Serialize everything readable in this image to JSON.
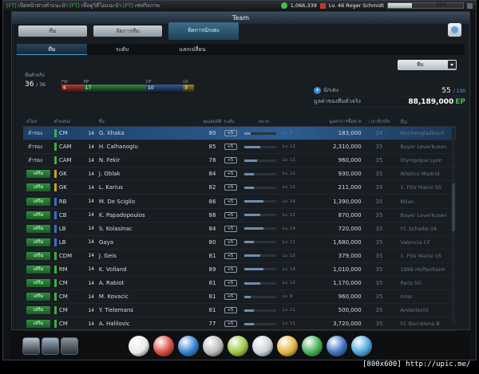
{
  "topbar": {
    "ticker_tag1": "[FT]",
    "ticker_text1": "เปิดหน้าต่างคำแนะนำ",
    "ticker_tag2": "[FT]",
    "ticker_text2": "เพื่อดูวิดีโอแนะนำ",
    "ticker_tag3": "[FT]",
    "ticker_text3": "เซฟกิจภาพ",
    "money": "1,066,339",
    "player_name": "Lv. 46 Roger Schmidt",
    "progress_label": "32%",
    "progress_value": 0.32
  },
  "window": {
    "title": "Team"
  },
  "tabs_main": [
    {
      "label": "ทีม"
    },
    {
      "label": "จัดการทีม"
    },
    {
      "label": "จัดการนักเตะ"
    }
  ],
  "tabs_sub": [
    {
      "label": "ทีม"
    },
    {
      "label": "ระดับ"
    },
    {
      "label": "แลกเปลี่ยน"
    }
  ],
  "filter": {
    "selected": "ทีม"
  },
  "team_strip": {
    "title": "ทีมตัวจริง",
    "count": "36",
    "total": "/ 36",
    "positions": [
      {
        "label": "FW",
        "count": "6",
        "color": "#c0392b"
      },
      {
        "label": "MF",
        "count": "17",
        "color": "#2f8f3e"
      },
      {
        "label": "DF",
        "count": "10",
        "color": "#2c5d9c"
      },
      {
        "label": "GK",
        "count": "3",
        "color": "#a08b1f"
      }
    ]
  },
  "info": {
    "players_label": "นักเตะ",
    "players_value": "55",
    "players_max": "/ 100",
    "value_label": "มูลค่าของทีมตัวจริง",
    "value_amount": "88,189,000",
    "value_unit": "EP"
  },
  "table_headers": [
    "สโมส",
    "ตำแหน่ง",
    "ชื่อ",
    "คุณสมบัติ",
    "ระดับ",
    "เลเวล",
    "มูลค่าการซื้อขาย",
    "เวลาที่เหลือ",
    "ทีม"
  ],
  "players": [
    {
      "status": "สำรอง",
      "badge": false,
      "pos": "CM",
      "poscolor": "#3fae3f",
      "name": "G. Xhaka",
      "ovr": "80",
      "lvl": "+5",
      "exp": 0.2,
      "lv": "Lv. 9",
      "price": "183,000",
      "age": "24",
      "club": "Mochengladbach",
      "selected": true
    },
    {
      "status": "สำรอง",
      "badge": false,
      "pos": "CAM",
      "poscolor": "#3fae3f",
      "name": "H. Calhanoglu",
      "ovr": "85",
      "lvl": "+5",
      "exp": 0.5,
      "lv": "Lv. 12",
      "price": "2,310,000",
      "age": "35",
      "club": "Bayer Leverkusen",
      "selected": false
    },
    {
      "status": "สำรอง",
      "badge": false,
      "pos": "CAM",
      "poscolor": "#3fae3f",
      "name": "N. Fekir",
      "ovr": "78",
      "lvl": "+5",
      "exp": 0.4,
      "lv": "Lv. 11",
      "price": "960,000",
      "age": "35",
      "club": "Olympique Lyon",
      "selected": false
    },
    {
      "status": "เสริม",
      "badge": true,
      "pos": "GK",
      "poscolor": "#c9a227",
      "name": "J. Oblak",
      "ovr": "84",
      "lvl": "+5",
      "exp": 0.3,
      "lv": "Lv. 11",
      "price": "930,000",
      "age": "35",
      "club": "Atletico Madrid",
      "selected": false
    },
    {
      "status": "เสริม",
      "badge": true,
      "pos": "GK",
      "poscolor": "#c9a227",
      "name": "L. Karius",
      "ovr": "82",
      "lvl": "+5",
      "exp": 0.3,
      "lv": "Lv. 11",
      "price": "211,000",
      "age": "39",
      "club": "1. FSV Mainz 05",
      "selected": false
    },
    {
      "status": "เสริม",
      "badge": true,
      "pos": "RB",
      "poscolor": "#3b6fc4",
      "name": "M. De Sciglio",
      "ovr": "86",
      "lvl": "+5",
      "exp": 0.6,
      "lv": "Lv. 14",
      "price": "1,390,000",
      "age": "35",
      "club": "Milan",
      "selected": false
    },
    {
      "status": "เสริม",
      "badge": true,
      "pos": "CB",
      "poscolor": "#3b6fc4",
      "name": "K. Papadopoulos",
      "ovr": "88",
      "lvl": "+5",
      "exp": 0.5,
      "lv": "Lv. 12",
      "price": "870,000",
      "age": "35",
      "club": "Bayer Leverkusen",
      "selected": false
    },
    {
      "status": "เสริม",
      "badge": true,
      "pos": "LB",
      "poscolor": "#3b6fc4",
      "name": "S. Kolasinac",
      "ovr": "84",
      "lvl": "+5",
      "exp": 0.6,
      "lv": "Lv. 14",
      "price": "720,000",
      "age": "35",
      "club": "FC Schalke 04",
      "selected": false
    },
    {
      "status": "เสริม",
      "badge": true,
      "pos": "LB",
      "poscolor": "#3b6fc4",
      "name": "Gaya",
      "ovr": "80",
      "lvl": "+5",
      "exp": 0.3,
      "lv": "Lv. 11",
      "price": "1,680,000",
      "age": "35",
      "club": "Valencia CF",
      "selected": false
    },
    {
      "status": "เสริม",
      "badge": true,
      "pos": "CDM",
      "poscolor": "#3fae3f",
      "name": "J. Geis",
      "ovr": "81",
      "lvl": "+5",
      "exp": 0.5,
      "lv": "Lv. 12",
      "price": "379,000",
      "age": "35",
      "club": "1. FSV Mainz 05",
      "selected": false
    },
    {
      "status": "เสริม",
      "badge": true,
      "pos": "RM",
      "poscolor": "#3fae3f",
      "name": "K. Volland",
      "ovr": "89",
      "lvl": "+5",
      "exp": 0.6,
      "lv": "Lv. 14",
      "price": "1,010,000",
      "age": "35",
      "club": "1899 Hoffenheim",
      "selected": false
    },
    {
      "status": "เสริม",
      "badge": true,
      "pos": "CM",
      "poscolor": "#3fae3f",
      "name": "A. Rabiot",
      "ovr": "81",
      "lvl": "+5",
      "exp": 0.5,
      "lv": "Lv. 12",
      "price": "1,170,000",
      "age": "35",
      "club": "Paris SG",
      "selected": false
    },
    {
      "status": "เสริม",
      "badge": true,
      "pos": "CM",
      "poscolor": "#3fae3f",
      "name": "M. Kovacic",
      "ovr": "81",
      "lvl": "+5",
      "exp": 0.2,
      "lv": "Lv. 9",
      "price": "960,000",
      "age": "35",
      "club": "Inter",
      "selected": false
    },
    {
      "status": "เสริม",
      "badge": true,
      "pos": "CM",
      "poscolor": "#3fae3f",
      "name": "Y. Tielemans",
      "ovr": "81",
      "lvl": "+5",
      "exp": 0.3,
      "lv": "Lv. 11",
      "price": "500,000",
      "age": "35",
      "club": "Anderlecht",
      "selected": false
    },
    {
      "status": "เสริม",
      "badge": true,
      "pos": "CM",
      "poscolor": "#3fae3f",
      "name": "A. Halilovic",
      "ovr": "77",
      "lvl": "+5",
      "exp": 0.3,
      "lv": "Lv. 11",
      "price": "3,720,000",
      "age": "35",
      "club": "FC Barcelona B",
      "selected": false
    }
  ],
  "toolbar_left": [
    {
      "name": "profile-icon",
      "color": "#b8c2cc"
    },
    {
      "name": "list-icon",
      "color": "#9fb3c8"
    },
    {
      "name": "mail-icon",
      "color": "#8a949e"
    }
  ],
  "toolbar_main": [
    {
      "name": "boot-icon",
      "color": "#e8e8e8"
    },
    {
      "name": "ball-icon",
      "color": "#d84a3a"
    },
    {
      "name": "shoe-icon",
      "color": "#2e7fd1"
    },
    {
      "name": "trophy-icon",
      "color": "#b9b9b9"
    },
    {
      "name": "pyramid-icon",
      "color": "#9bc53d"
    },
    {
      "name": "book-icon",
      "color": "#c8d0d8"
    },
    {
      "name": "medal-icon",
      "color": "#e0b53a"
    },
    {
      "name": "chip-icon",
      "color": "#3fae4f"
    },
    {
      "name": "pen-icon",
      "color": "#3b6fc4"
    },
    {
      "name": "cart-icon",
      "color": "#4aa3da"
    }
  ],
  "caption": "[800x600] http://upic.me/"
}
